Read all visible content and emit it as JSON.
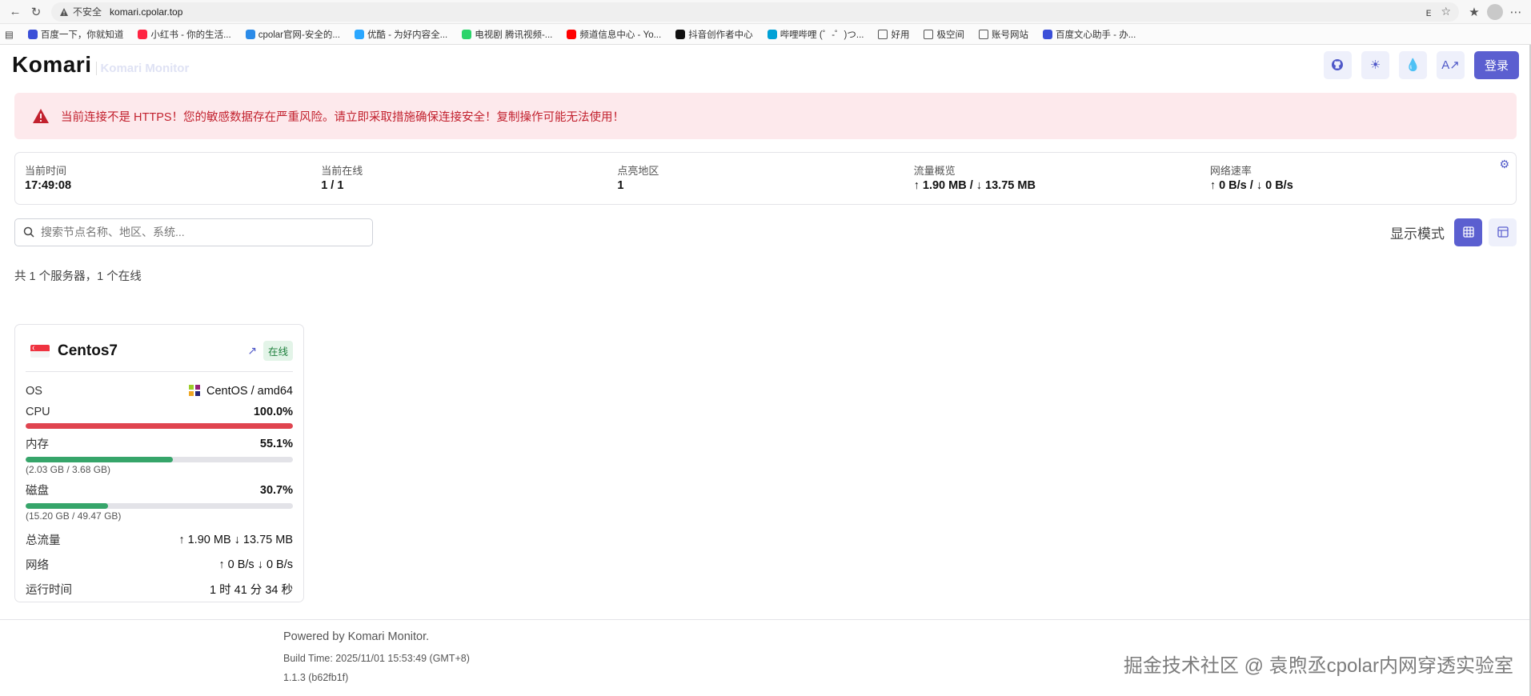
{
  "browser": {
    "insecure_label": "不安全",
    "url": "komari.cpolar.top",
    "bookmarks": [
      {
        "label": "百度一下，你就知道",
        "color": "#3b4fd8"
      },
      {
        "label": "小红书 - 你的生活...",
        "color": "#ff2442"
      },
      {
        "label": "cpolar官网-安全的...",
        "color": "#2b8be8"
      },
      {
        "label": "优酷 - 为好内容全...",
        "color": "#2aa7ff"
      },
      {
        "label": "电视剧 腾讯视频-...",
        "color": "#2bd46a"
      },
      {
        "label": "频道信息中心 - Yo...",
        "color": "#ff0000"
      },
      {
        "label": "抖音创作者中心",
        "color": "#111111"
      },
      {
        "label": "哔哩哔哩 (゜-゜)つ...",
        "color": "#00a1d6"
      },
      {
        "label": "好用",
        "color": "folder"
      },
      {
        "label": "极空间",
        "color": "folder"
      },
      {
        "label": "账号网站",
        "color": "folder"
      },
      {
        "label": "百度文心助手 - 办...",
        "color": "#3b4fd8"
      }
    ]
  },
  "header": {
    "logo": "Komari",
    "subtitle": "Komari Monitor",
    "login_label": "登录"
  },
  "alert": {
    "message": "当前连接不是 HTTPS！您的敏感数据存在严重风险。请立即采取措施确保连接安全！复制操作可能无法使用！",
    "color": "#c2212e"
  },
  "stats": [
    {
      "label": "当前时间",
      "value": "17:49:08"
    },
    {
      "label": "当前在线",
      "value": "1 / 1"
    },
    {
      "label": "点亮地区",
      "value": "1"
    },
    {
      "label": "流量概览",
      "value": "↑ 1.90 MB / ↓ 13.75 MB"
    },
    {
      "label": "网络速率",
      "value": "↑ 0 B/s / ↓ 0 B/s"
    }
  ],
  "search": {
    "placeholder": "搜索节点名称、地区、系统..."
  },
  "view_mode": {
    "label": "显示模式"
  },
  "summary": "共 1 个服务器，1 个在线",
  "server": {
    "name": "Centos7",
    "status": "在线",
    "os_label": "OS",
    "os_value": "CentOS / amd64",
    "cpu_label": "CPU",
    "cpu_value": "100.0%",
    "cpu_fraction": 1.0,
    "mem_label": "内存",
    "mem_value": "55.1%",
    "mem_fraction": 0.551,
    "mem_detail": "(2.03 GB / 3.68 GB)",
    "disk_label": "磁盘",
    "disk_value": "30.7%",
    "disk_fraction": 0.307,
    "disk_detail": "(15.20 GB / 49.47 GB)",
    "traffic_label": "总流量",
    "traffic_value": "↑ 1.90 MB ↓ 13.75 MB",
    "network_label": "网络",
    "network_value": "↑ 0 B/s ↓ 0 B/s",
    "uptime_label": "运行时间",
    "uptime_value": "1 时 41 分 34 秒",
    "colors": {
      "cpu": "#e0444f",
      "mem": "#36a56a",
      "disk": "#36a56a"
    }
  },
  "footer": {
    "powered": "Powered by Komari Monitor.",
    "build_time": "Build Time: 2025/11/01 15:53:49 (GMT+8)",
    "version": "1.1.3 (b62fb1f)"
  },
  "watermark": "掘金技术社区 @ 袁煦丞cpolar内网穿透实验室"
}
